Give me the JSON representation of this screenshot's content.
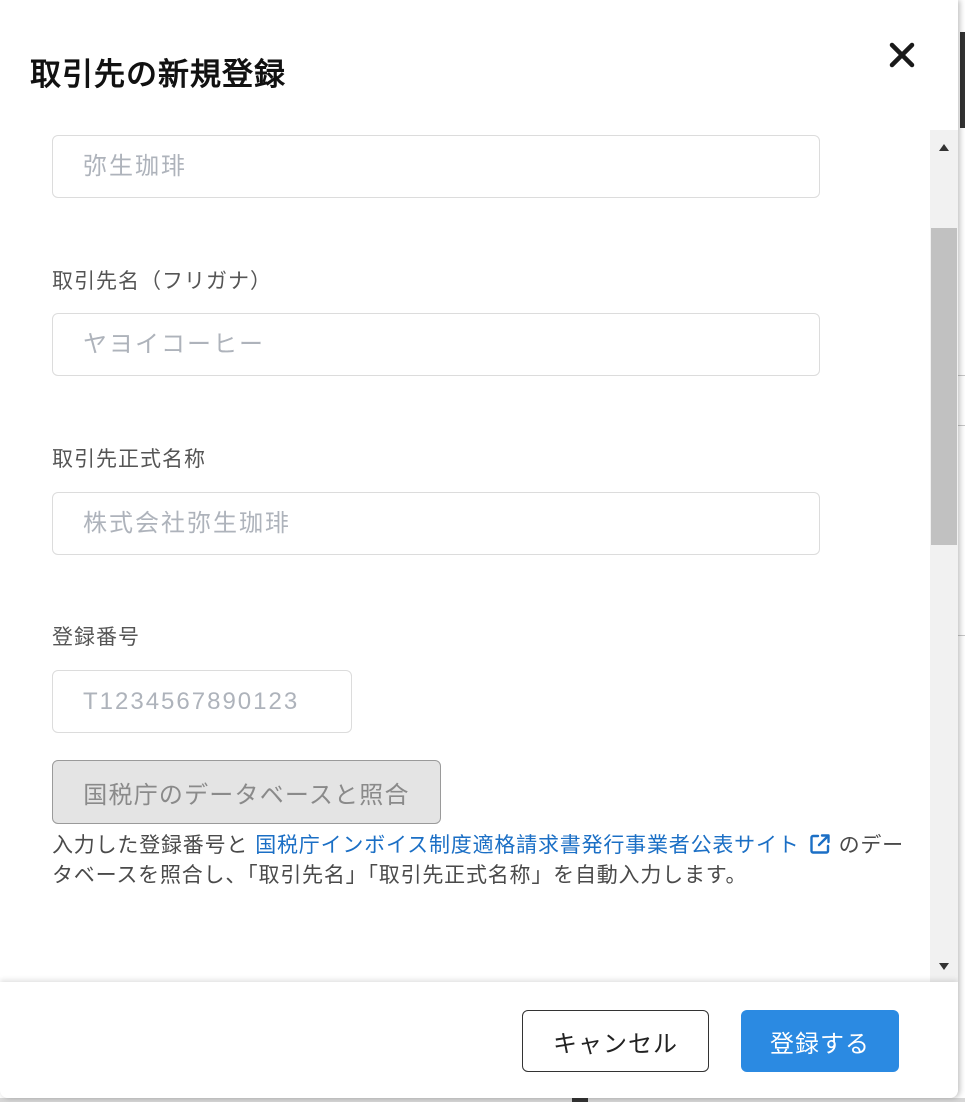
{
  "dialog": {
    "title": "取引先の新規登録"
  },
  "form": {
    "name": {
      "placeholder": "弥生珈琲",
      "value": ""
    },
    "name_kana": {
      "label": "取引先名（フリガナ）",
      "placeholder": "ヤヨイコーヒー",
      "value": ""
    },
    "official_name": {
      "label": "取引先正式名称",
      "placeholder": "株式会社弥生珈琲",
      "value": ""
    },
    "registration_number": {
      "label": "登録番号",
      "placeholder": "T1234567890123",
      "value": ""
    },
    "verify_button": {
      "label": "国税庁のデータベースと照合",
      "disabled": true
    },
    "help": {
      "prefix": "入力した登録番号と",
      "link_text": "国税庁インボイス制度適格請求書発行事業者公表サイト",
      "suffix": "のデータベースを照合し、「取引先名」「取引先正式名称」を自動入力します。"
    }
  },
  "footer": {
    "cancel_label": "キャンセル",
    "submit_label": "登録する"
  },
  "icons": {
    "close": "close-icon",
    "external_link": "external-link-icon",
    "scroll_up": "triangle-up-icon",
    "scroll_down": "triangle-down-icon"
  },
  "colors": {
    "primary": "#2b8ae2",
    "link": "#1b6fc5",
    "disabled_bg": "#e4e4e4",
    "disabled_border": "#9a9a9a",
    "disabled_text": "#8a8a8a"
  }
}
